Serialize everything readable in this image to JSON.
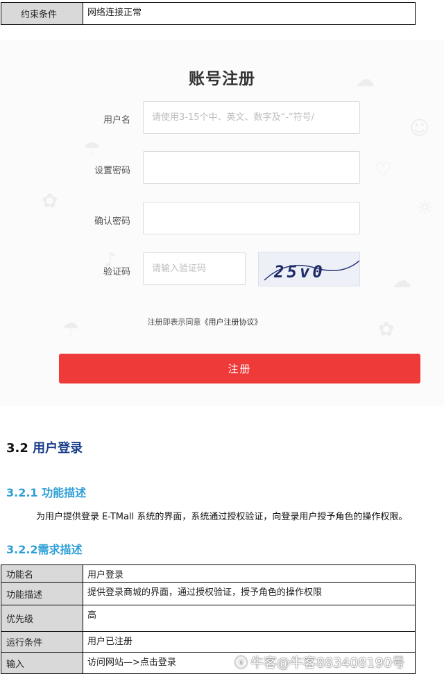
{
  "constraint_row": {
    "label": "约束条件",
    "value": "网络连接正常"
  },
  "register": {
    "title": "账号注册",
    "username": {
      "label": "用户名",
      "placeholder": "请使用3-15个中、英文、数字及“-”符号/"
    },
    "password": {
      "label": "设置密码",
      "placeholder": ""
    },
    "confirm": {
      "label": "确认密码",
      "placeholder": ""
    },
    "captcha": {
      "label": "验证码",
      "placeholder": "请输入验证码",
      "image_text": "25v0"
    },
    "agree_prefix": "注册即表示同意",
    "agree_link": "《用户注册协议》",
    "button": "注册"
  },
  "section": {
    "h2_num": "3.2",
    "h2_text": "用户登录",
    "h3a": "3.2.1  功能描述",
    "para": "为用户提供登录 E-TMall 系统的界面，系统通过授权验证，向登录用户授予角色的操作权限。",
    "h3b": "3.2.2需求描述"
  },
  "req_table": [
    {
      "key": "功能名",
      "value": "用户登录"
    },
    {
      "key": "功能描述",
      "value": "提供登录商城的界面，通过授权验证，授予角色的操作权限"
    },
    {
      "key": "优先级",
      "value": "高"
    },
    {
      "key": "运行条件",
      "value": "用户已注册"
    },
    {
      "key": "输入",
      "value": "访问网站—>点击登录"
    }
  ],
  "watermark": "牛客@牛客883408190号",
  "colors": {
    "accent_red": "#ef3a3a",
    "heading_blue": "#1a3f8a",
    "subheading_blue": "#2e9fd6",
    "label_gray": "#d9d9d9"
  }
}
